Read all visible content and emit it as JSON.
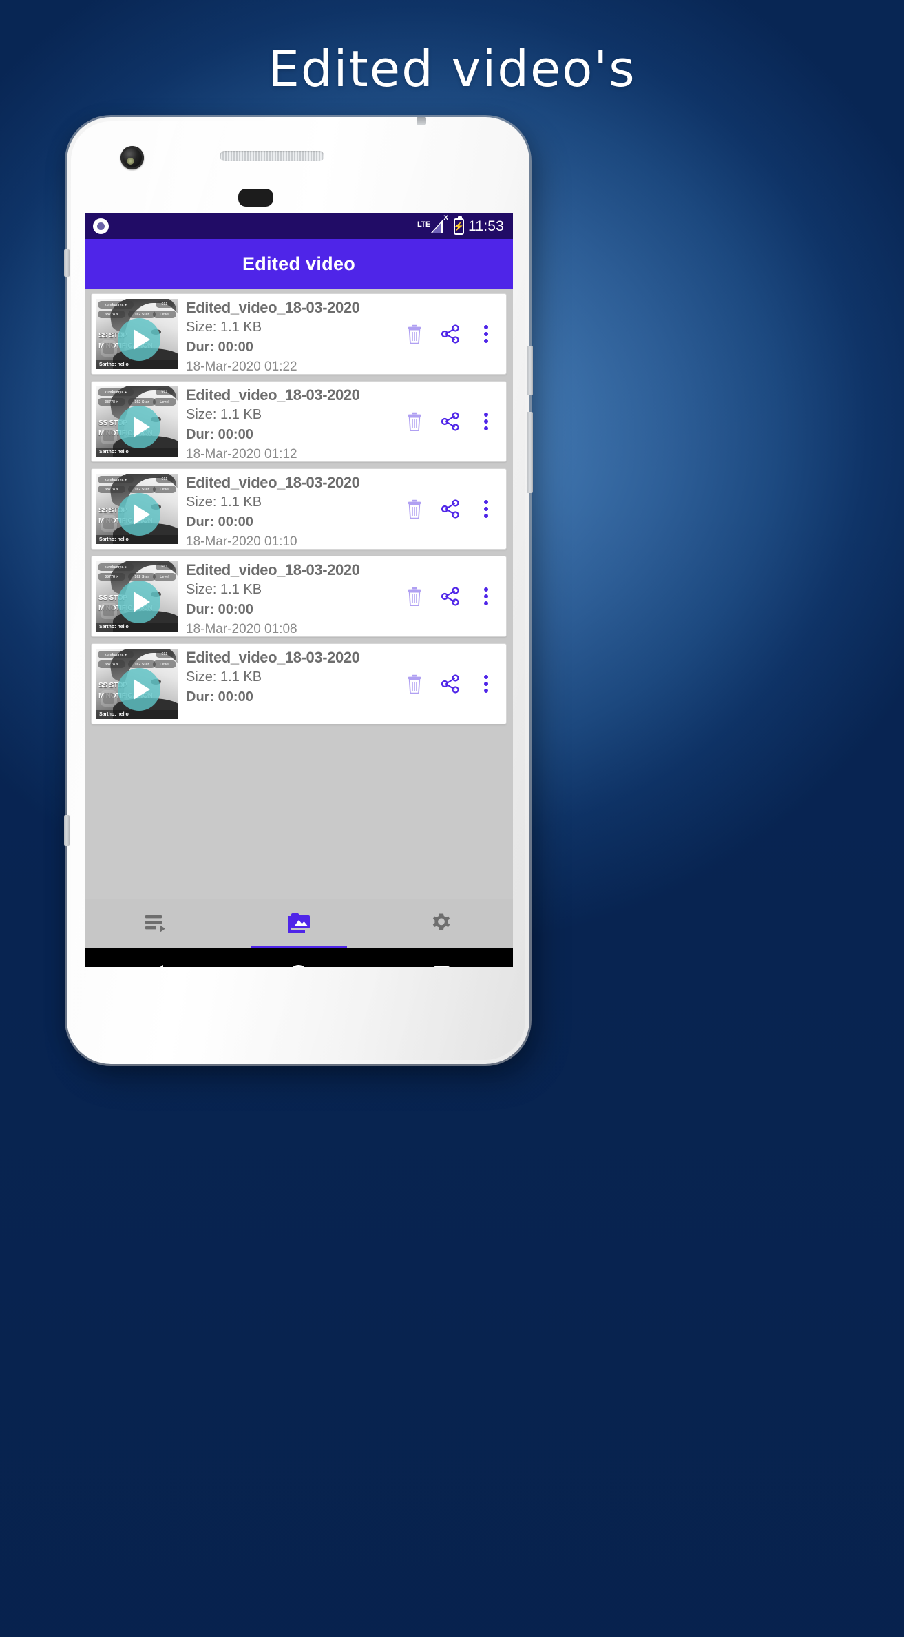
{
  "poster": {
    "title": "Edited video's",
    "background_top_color": "#4d82b8",
    "background_bottom_color": "#082553"
  },
  "status_bar": {
    "notification_icon": "circle-record-icon",
    "network_label": "LTE",
    "signal_cross": "x",
    "battery_icon": "battery-charging-icon",
    "time": "11:53",
    "background_color": "#210c66"
  },
  "app_bar": {
    "title": "Edited video",
    "background_color": "#4f25e8",
    "text_color": "#ffffff"
  },
  "list": {
    "background_color": "#c9c9c9",
    "accent_color": "#4f25e8",
    "thumbnail": {
      "pill_1": "kumkumya  ●",
      "pill_2": "38778  >",
      "pill_3": "162 Star",
      "pill_4": "601",
      "pill_5": "Level",
      "overlay_line_1": "SS STOP",
      "overlay_line_2": "M NOTIFICATION",
      "caption": "Sartho: hello",
      "play_icon": "play-circle-icon"
    },
    "actions": {
      "delete_icon": "trash-icon",
      "share_icon": "share-nodes-icon",
      "more_icon": "kebab-menu-icon"
    },
    "items": [
      {
        "title": "Edited_video_18-03-2020",
        "size": "Size: 1.1 KB",
        "duration": "Dur: 00:00",
        "date": "18-Mar-2020 01:22"
      },
      {
        "title": "Edited_video_18-03-2020",
        "size": "Size: 1.1 KB",
        "duration": "Dur: 00:00",
        "date": "18-Mar-2020 01:12"
      },
      {
        "title": "Edited_video_18-03-2020",
        "size": "Size: 1.1 KB",
        "duration": "Dur: 00:00",
        "date": "18-Mar-2020 01:10"
      },
      {
        "title": "Edited_video_18-03-2020",
        "size": "Size: 1.1 KB",
        "duration": "Dur: 00:00",
        "date": "18-Mar-2020 01:08"
      },
      {
        "title": "Edited_video_18-03-2020",
        "size": "Size: 1.1 KB",
        "duration": "Dur: 00:00",
        "date": ""
      }
    ]
  },
  "bottom_nav": {
    "background_color": "#c6c6c6",
    "inactive_color": "#6e6e6e",
    "active_color": "#4f25e8",
    "items": [
      {
        "icon": "playlist-play-icon",
        "active": false
      },
      {
        "icon": "photo-library-icon",
        "active": true
      },
      {
        "icon": "gear-icon",
        "active": false
      }
    ]
  },
  "android_nav": {
    "back_icon": "triangle-back-icon",
    "home_icon": "circle-home-icon",
    "recents_icon": "square-recents-icon"
  }
}
